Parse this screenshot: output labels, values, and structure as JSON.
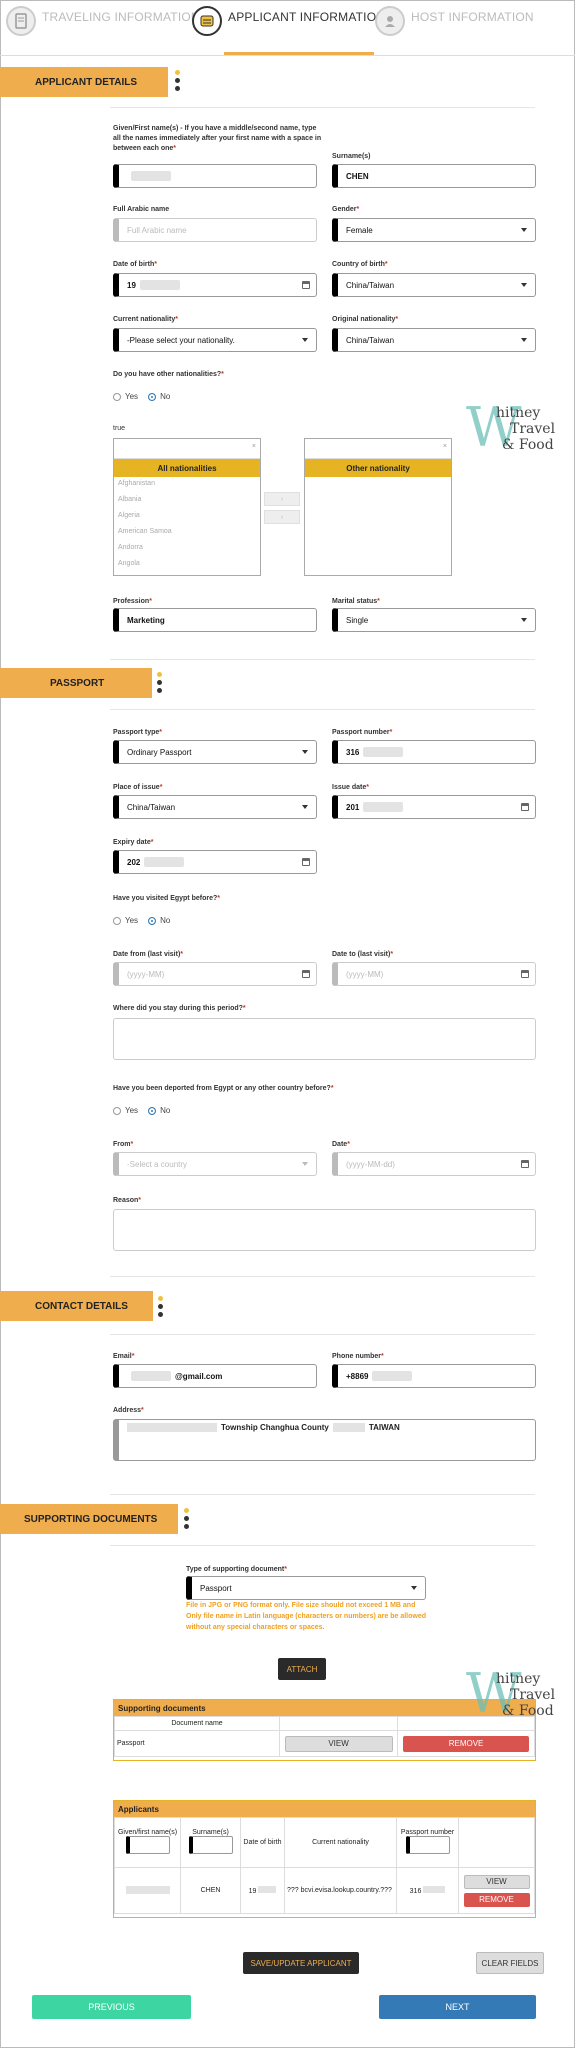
{
  "steps": [
    {
      "label": "TRAVELING INFORMATION",
      "icon": "document-icon"
    },
    {
      "label": "APPLICANT INFORMATION",
      "icon": "id-card-icon"
    },
    {
      "label": "HOST INFORMATION",
      "icon": "person-icon"
    }
  ],
  "sections": {
    "applicant": "APPLICANT DETAILS",
    "passport": "PASSPORT",
    "contact": "CONTACT DETAILS",
    "documents": "SUPPORTING DOCUMENTS"
  },
  "applicant": {
    "given_label": "Given/First name(s) - If you have a middle/second name, type all the names immediately after your first name with a space in between each one",
    "surname_label": "Surname(s)",
    "surname_value": "CHEN",
    "arabic_label": "Full Arabic name",
    "arabic_placeholder": "Full Arabic name",
    "gender_label": "Gender",
    "gender_value": "Female",
    "dob_label": "Date of birth",
    "dob_value": "19",
    "cob_label": "Country of birth",
    "cob_value": "China/Taiwan",
    "curnat_label": "Current nationality",
    "curnat_value": "-Please select your nationality.",
    "orignat_label": "Original nationality",
    "orignat_value": "China/Taiwan",
    "othernat_label": "Do you have other nationalities?",
    "yes": "Yes",
    "no": "No",
    "true_text": "true",
    "all_nat_header": "All nationalities",
    "other_nat_header": "Other nationality",
    "nationalities": [
      "Afghanistan",
      "Albania",
      "Algeria",
      "American Samoa",
      "Andorra",
      "Angola"
    ],
    "move_right": "›",
    "move_left": "‹",
    "profession_label": "Profession",
    "profession_value": "Marketing",
    "marital_label": "Marital status",
    "marital_value": "Single"
  },
  "passport": {
    "type_label": "Passport type",
    "type_value": "Ordinary Passport",
    "number_label": "Passport number",
    "number_value": "316",
    "place_label": "Place of issue",
    "place_value": "China/Taiwan",
    "issue_label": "Issue date",
    "issue_value": "201",
    "expiry_label": "Expiry date",
    "expiry_value": "202",
    "visited_label": "Have you visited Egypt before?",
    "from_label": "Date from (last visit)",
    "to_label": "Date to (last visit)",
    "date_placeholder": "(yyyy-MM)",
    "stay_label": "Where did you stay during this period?",
    "deported_label": "Have you been deported from Egypt or any other country before?",
    "dep_from_label": "From",
    "dep_from_placeholder": "-Select a country",
    "dep_date_label": "Date",
    "dep_date_placeholder": "(yyyy-MM-dd)",
    "reason_label": "Reason"
  },
  "contact": {
    "email_label": "Email",
    "email_value": "@gmail.com",
    "phone_label": "Phone number",
    "phone_value": "+8869",
    "address_label": "Address",
    "address_value": "Township Changhua County",
    "address_country": "TAIWAN"
  },
  "documents": {
    "type_label": "Type of supporting document",
    "type_value": "Passport",
    "note": "File in JPG or PNG format only. File size should not exceed 1 MB and Only file name in Latin language (characters or numbers) are be allowed without any special characters or spaces.",
    "attach": "ATTACH",
    "panel_title": "Supporting documents",
    "col_name": "Document name",
    "row_name": "Passport",
    "view": "VIEW",
    "remove": "REMOVE"
  },
  "applicants_table": {
    "title": "Applicants",
    "cols": [
      "Given/first name(s)",
      "Surname(s)",
      "Date of birth",
      "Current nationality",
      "Passport number"
    ],
    "row": {
      "surname": "CHEN",
      "dob": "19",
      "nationality": "??? bcvi.evisa.lookup.country.???",
      "passport": "316"
    }
  },
  "actions": {
    "save": "SAVE/UPDATE APPLICANT",
    "clear": "CLEAR FIELDS",
    "previous": "PREVIOUS",
    "next": "NEXT"
  },
  "watermark": {
    "w": "W",
    "line1": "hitney",
    "line2": "Travel",
    "line3": "& Food"
  },
  "colors": {
    "accent": "#f0ad4e",
    "gold": "#e6b422",
    "required": "#c0392b",
    "prev": "#3dd6a3",
    "next": "#337ab7",
    "remove": "#d9534f"
  }
}
